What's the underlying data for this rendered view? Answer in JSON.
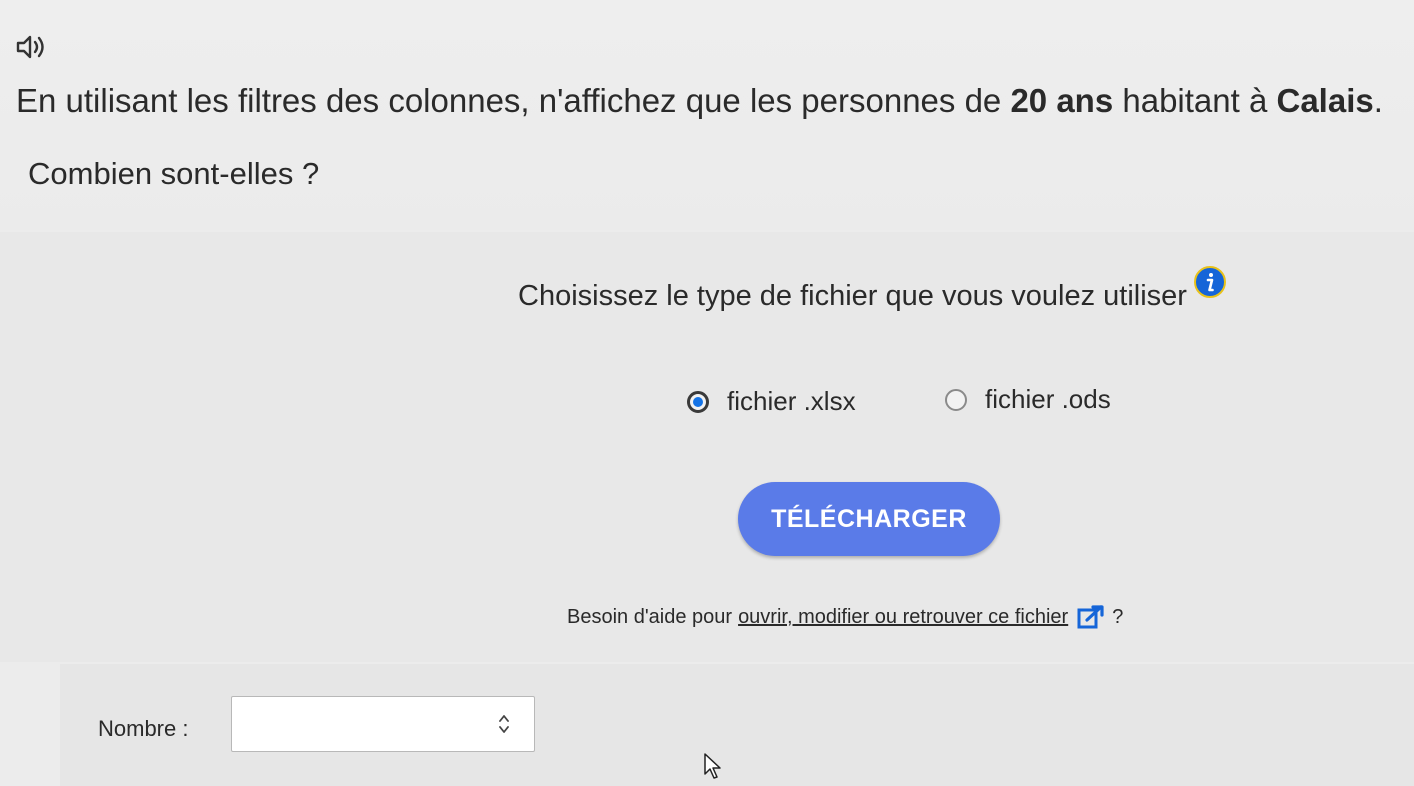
{
  "question": {
    "line1_before": "En utilisant les filtres des colonnes, n'affichez que les personnes de ",
    "line1_bold1": "20 ans",
    "line1_middle": " habitant à ",
    "line1_bold2": "Calais",
    "line1_end": ".",
    "line2": "Combien sont-elles ?"
  },
  "file_choice": {
    "prompt": "Choisissez le type de fichier que vous voulez utiliser",
    "options": [
      {
        "label": "fichier .xlsx",
        "selected": true
      },
      {
        "label": "fichier .ods",
        "selected": false
      }
    ],
    "download_label": "TÉLÉCHARGER"
  },
  "help": {
    "prefix": "Besoin d'aide pour",
    "link_text": "ouvrir, modifier ou retrouver ce fichier",
    "suffix": "?"
  },
  "answer": {
    "label": "Nombre :",
    "value": ""
  },
  "icons": {
    "audio": "speaker-icon",
    "info": "info-icon",
    "external": "external-link-icon",
    "spinner": "spinner-arrows-icon",
    "cursor": "mouse-cursor-icon"
  },
  "colors": {
    "accent": "#5a7be8",
    "radio_selected": "#1473e6",
    "info": "#1565d8"
  }
}
